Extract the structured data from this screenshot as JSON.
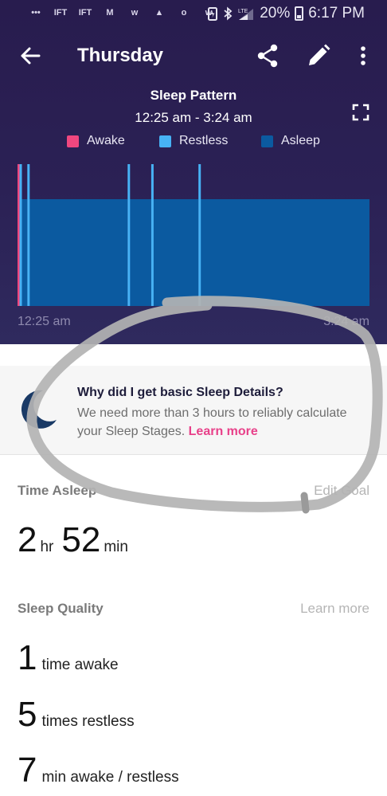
{
  "status_bar": {
    "left_icons": [
      "chat-icon",
      "ifttt-icon",
      "ifttt-icon",
      "mail-icon",
      "w-icon",
      "drive-icon",
      "o-icon",
      "w-icon"
    ],
    "icon_labels": [
      "•••",
      "IFT",
      "IFT",
      "M",
      "w",
      "▲",
      "o",
      "w"
    ],
    "battery": "20%",
    "time": "6:17 PM"
  },
  "appbar": {
    "title": "Thursday"
  },
  "chart": {
    "title": "Sleep Pattern",
    "range": "12:25 am - 3:24 am",
    "axis_start": "12:25 am",
    "axis_end": "3:24 am"
  },
  "chart_data": {
    "type": "bar",
    "title": "Sleep Pattern",
    "x_start": "12:25 am",
    "x_end": "3:24 am",
    "duration_min": 179,
    "legend_placement": "top",
    "series": [
      {
        "name": "Awake",
        "color": "#f0477f",
        "level": 3
      },
      {
        "name": "Restless",
        "color": "#47b2f5",
        "level": 3
      },
      {
        "name": "Asleep",
        "color": "#0b5aa0",
        "level": 2
      }
    ],
    "segments": [
      {
        "state": "Awake",
        "start_min": 0,
        "end_min": 1
      },
      {
        "state": "Restless",
        "start_min": 1,
        "end_min": 2
      },
      {
        "state": "Asleep",
        "start_min": 2,
        "end_min": 5
      },
      {
        "state": "Restless",
        "start_min": 5,
        "end_min": 6
      },
      {
        "state": "Asleep",
        "start_min": 6,
        "end_min": 56
      },
      {
        "state": "Restless",
        "start_min": 56,
        "end_min": 57
      },
      {
        "state": "Asleep",
        "start_min": 57,
        "end_min": 68
      },
      {
        "state": "Restless",
        "start_min": 68,
        "end_min": 69
      },
      {
        "state": "Asleep",
        "start_min": 69,
        "end_min": 92
      },
      {
        "state": "Restless",
        "start_min": 92,
        "end_min": 93
      },
      {
        "state": "Asleep",
        "start_min": 93,
        "end_min": 179
      }
    ]
  },
  "notice": {
    "title": "Why did I get basic Sleep Details?",
    "body": "We need more than 3 hours to reliably calculate your Sleep Stages.",
    "link": "Learn more"
  },
  "time_asleep": {
    "label": "Time Asleep",
    "edit_goal": "Edit Goal",
    "hours": "2",
    "hours_unit": "hr",
    "minutes": "52",
    "minutes_unit": "min"
  },
  "sleep_quality": {
    "label": "Sleep Quality",
    "learn_more": "Learn more",
    "rows": [
      {
        "value": "1",
        "text": "time awake"
      },
      {
        "value": "5",
        "text": "times restless"
      },
      {
        "value": "7",
        "text": "min awake / restless"
      }
    ]
  },
  "colors": {
    "header_bg": "#2b2155",
    "awake": "#f0477f",
    "restless": "#47b2f5",
    "asleep": "#0b5aa0",
    "link_pink": "#e8418a",
    "moon": "#1a3a66",
    "annotation": "#b3b3b3"
  }
}
